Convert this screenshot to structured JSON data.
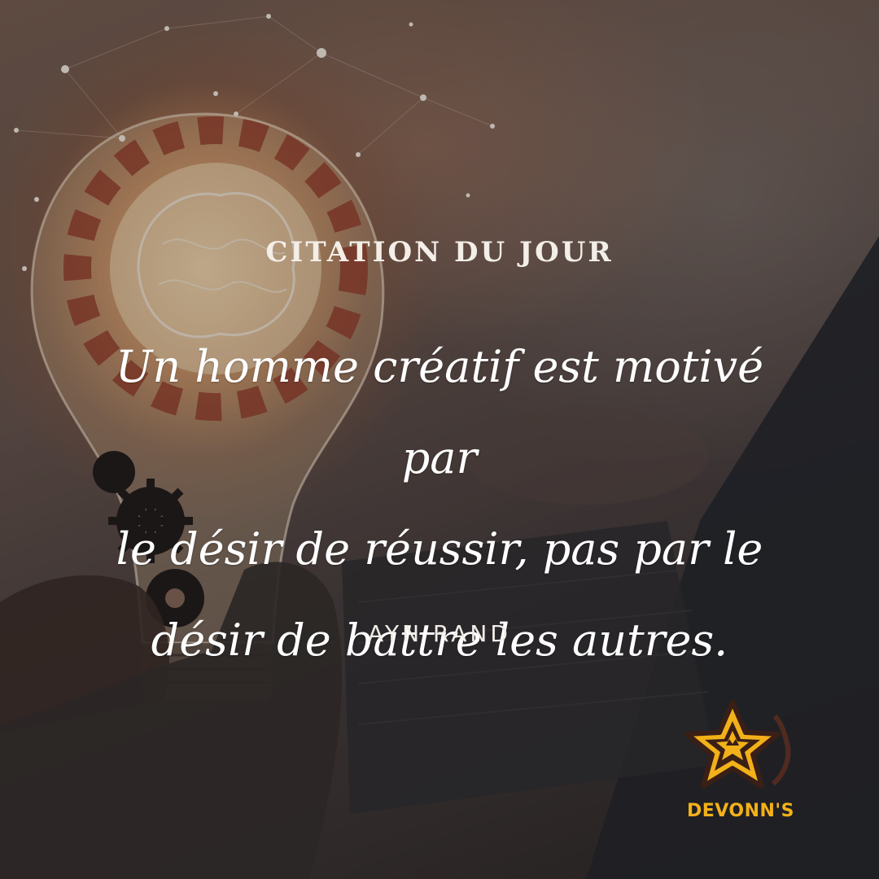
{
  "post": {
    "heading": "CITATION DU JOUR",
    "quote_lines": [
      "Un homme créatif est motivé par",
      "le désir de réussir, pas par le",
      "désir de battre les autres."
    ],
    "author": "AYN RAND"
  },
  "brand": {
    "logo_icon": "star-logo-icon",
    "name": "DEVONN'S",
    "accent_color": "#f3b119"
  },
  "background": {
    "subject": "lightbulb-with-brain-and-gears",
    "icons": [
      "lightbulb-icon",
      "gear-icon",
      "laptop-icon",
      "hand-icon"
    ]
  }
}
